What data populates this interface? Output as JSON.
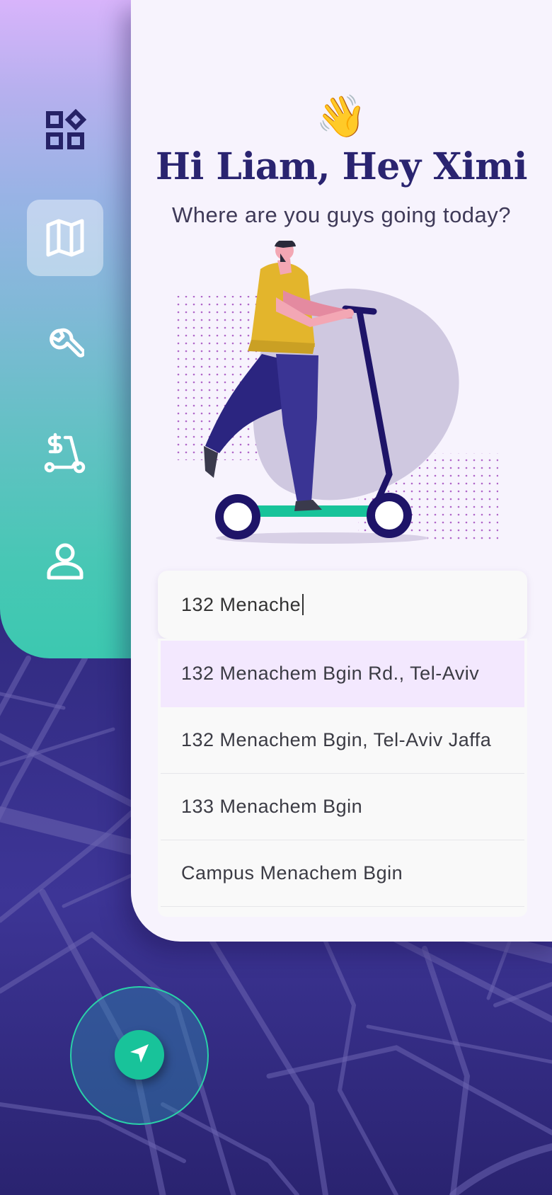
{
  "nav": {
    "items": [
      {
        "icon": "dashboard-icon",
        "active": false
      },
      {
        "icon": "map-icon",
        "active": true
      },
      {
        "icon": "wrench-icon",
        "active": false
      },
      {
        "icon": "scooter-payment-icon",
        "active": false
      },
      {
        "icon": "profile-icon",
        "active": false
      }
    ]
  },
  "greeting": {
    "emoji": "👋",
    "title": "Hi Liam, Hey Ximi",
    "subtitle": "Where are you guys going today?"
  },
  "search": {
    "value": "132 Menache",
    "suggestions": [
      "132 Menachem Bgin Rd., Tel-Aviv",
      "132 Menachem Bgin, Tel-Aviv Jaffa",
      "133 Menachem Bgin",
      "Campus Menachem Bgin"
    ]
  },
  "location_button": {
    "icon": "navigation-arrow-icon"
  },
  "colors": {
    "accent": "#18c39a",
    "title": "#2a2470",
    "highlight": "#f3e8fe",
    "map": "#21195e"
  }
}
